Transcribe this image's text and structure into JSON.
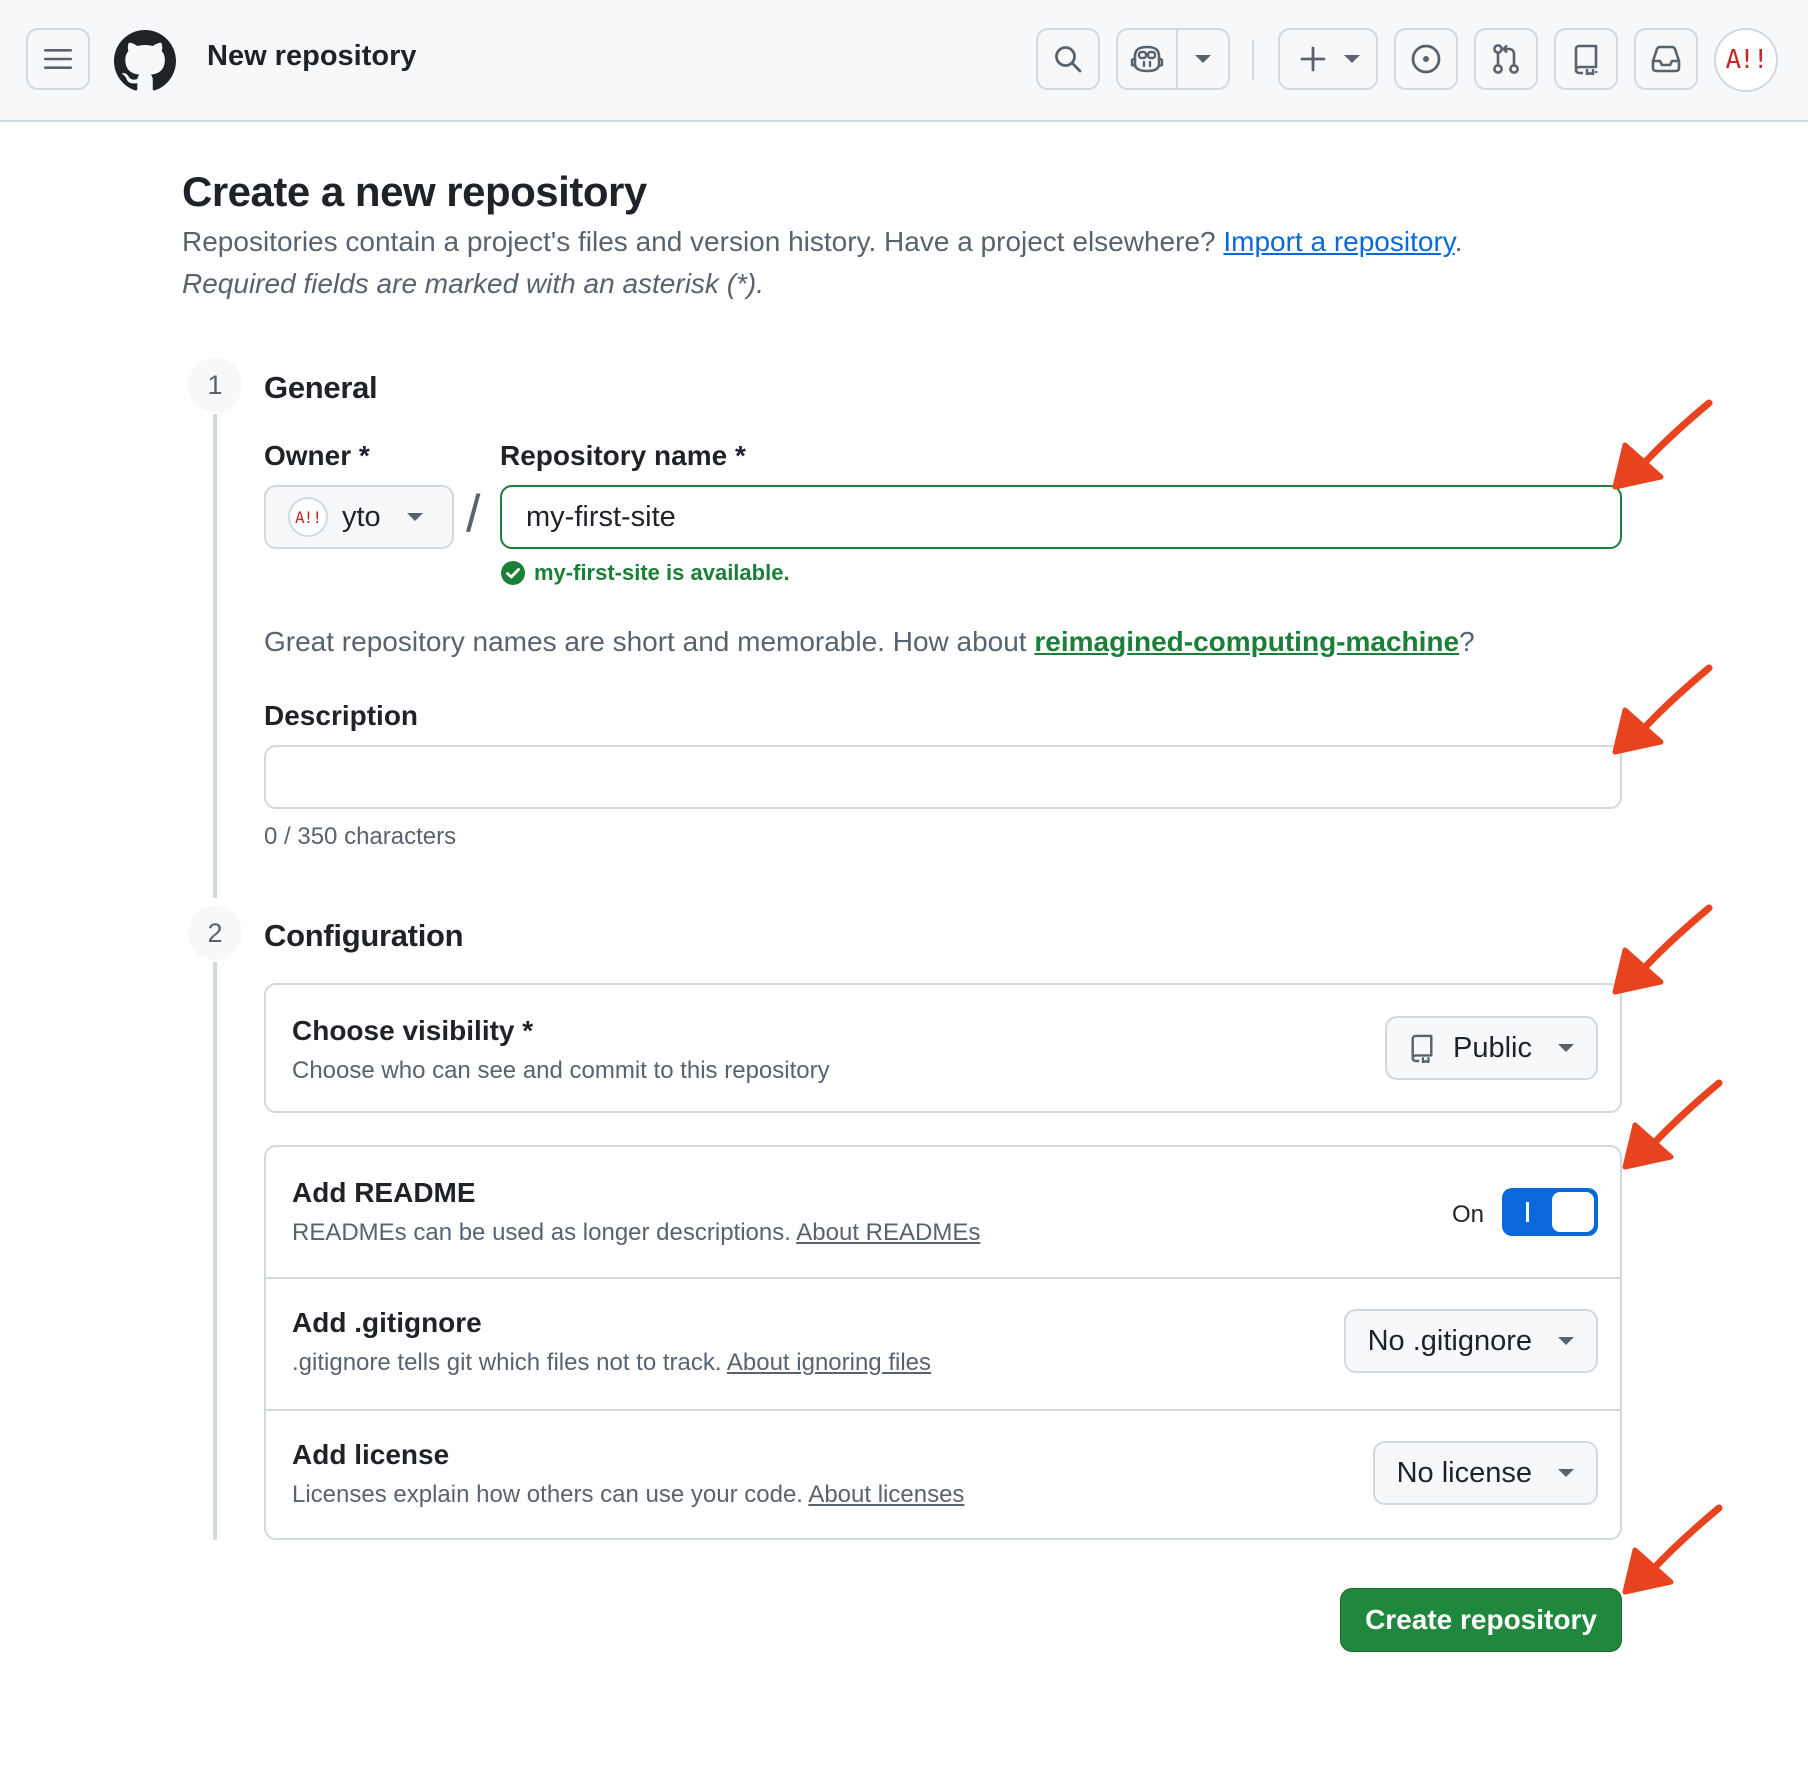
{
  "header": {
    "title": "New repository",
    "avatar_text": "A!!"
  },
  "intro": {
    "title": "Create a new repository",
    "text": "Repositories contain a project's files and version history. Have a project elsewhere?",
    "import_link": "Import a repository",
    "period": ".",
    "required_note": "Required fields are marked with an asterisk (*)."
  },
  "general": {
    "step": "1",
    "title": "General",
    "owner_label": "Owner *",
    "owner_value": "yto",
    "separator": "/",
    "repo_label": "Repository name *",
    "repo_value": "my-first-site",
    "available_text": "my-first-site is available.",
    "suggest_text": "Great repository names are short and memorable. How about",
    "suggest_link": "reimagined-computing-machine",
    "suggest_end": "?",
    "description_label": "Description",
    "description_value": "",
    "char_count": "0 / 350 characters"
  },
  "configuration": {
    "step": "2",
    "title": "Configuration",
    "visibility": {
      "title": "Choose visibility *",
      "sub": "Choose who can see and commit to this repository",
      "value": "Public"
    },
    "readme": {
      "title": "Add README",
      "sub": "READMEs can be used as longer descriptions.",
      "link": "About READMEs",
      "toggle_label": "On"
    },
    "gitignore": {
      "title": "Add .gitignore",
      "sub": ".gitignore tells git which files not to track.",
      "link": "About ignoring files",
      "value": "No .gitignore"
    },
    "license": {
      "title": "Add license",
      "sub": "Licenses explain how others can use your code.",
      "link": "About licenses",
      "value": "No license"
    }
  },
  "submit_label": "Create repository",
  "colors": {
    "accent_green": "#1f883d",
    "link_blue": "#0969da",
    "annotation_red": "#e8431f"
  }
}
